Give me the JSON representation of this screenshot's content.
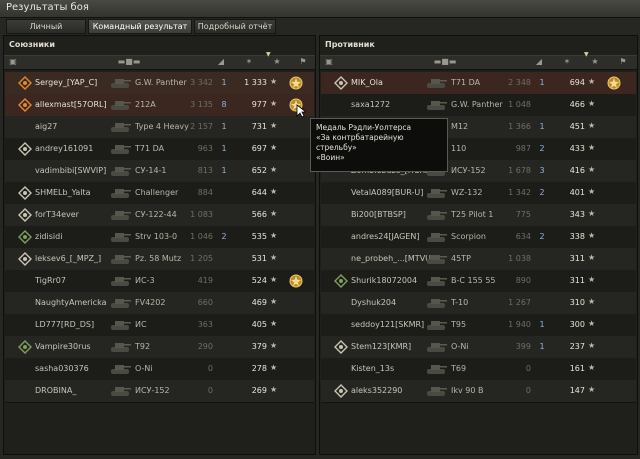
{
  "window": {
    "title": "Результаты боя"
  },
  "tabs": [
    "Личный результат",
    "Командный результат",
    "Подробный отчёт"
  ],
  "allies": {
    "title": "Союзники",
    "rows": [
      {
        "player": "Sergey_[YAP_C]",
        "tank": "G.W. Panther",
        "dmg": "3 342",
        "frags": "1",
        "xp": "1 333",
        "icon": "vehicle-icon-orange",
        "medal": true,
        "state": "me"
      },
      {
        "player": "allexmast[57ORL]",
        "tank": "212A",
        "dmg": "3 135",
        "frags": "8",
        "xp": "977",
        "icon": "vehicle-icon-orange",
        "medal": true,
        "state": "mark"
      },
      {
        "player": "aig27",
        "tank": "Type 4 Heavy",
        "dmg": "2 157",
        "frags": "1",
        "xp": "731",
        "icon": "",
        "medal": false,
        "state": "dead"
      },
      {
        "player": "andrey161091",
        "tank": "T71 DA",
        "dmg": "963",
        "frags": "1",
        "xp": "697",
        "icon": "vehicle-icon",
        "medal": false,
        "state": "dead"
      },
      {
        "player": "vadimbibi[SWVIP]",
        "tank": "СУ-14-1",
        "dmg": "813",
        "frags": "1",
        "xp": "652",
        "icon": "",
        "medal": false,
        "state": "dead"
      },
      {
        "player": "SHMELb_Yalta",
        "tank": "Challenger",
        "dmg": "884",
        "frags": "",
        "xp": "644",
        "icon": "vehicle-icon",
        "medal": false,
        "state": "dead"
      },
      {
        "player": "forT34ever",
        "tank": "СУ-122-44",
        "dmg": "1 083",
        "frags": "",
        "xp": "566",
        "icon": "vehicle-icon",
        "medal": false,
        "state": "dead"
      },
      {
        "player": "zidisidi",
        "tank": "Strv 103-0",
        "dmg": "1 046",
        "frags": "2",
        "xp": "535",
        "icon": "vehicle-icon-green",
        "medal": false,
        "state": "dead"
      },
      {
        "player": "leksev6_[_MPZ_]",
        "tank": "Pz. 58 Mutz",
        "dmg": "1 205",
        "frags": "",
        "xp": "531",
        "icon": "vehicle-icon",
        "medal": false,
        "state": "dead"
      },
      {
        "player": "TigRr07",
        "tank": "ИС-3",
        "dmg": "419",
        "frags": "",
        "xp": "524",
        "icon": "",
        "medal": true,
        "state": "dead"
      },
      {
        "player": "NaughtyAmericka",
        "tank": "FV4202",
        "dmg": "660",
        "frags": "",
        "xp": "469",
        "icon": "",
        "medal": false,
        "state": "dead"
      },
      {
        "player": "LD777[RD_DS]",
        "tank": "ИС",
        "dmg": "363",
        "frags": "",
        "xp": "405",
        "icon": "",
        "medal": false,
        "state": "dead"
      },
      {
        "player": "Vampire30rus",
        "tank": "T92",
        "dmg": "290",
        "frags": "",
        "xp": "379",
        "icon": "vehicle-icon-green",
        "medal": false,
        "state": "dead"
      },
      {
        "player": "sasha030376",
        "tank": "O-Ni",
        "dmg": "0",
        "frags": "",
        "xp": "278",
        "icon": "",
        "medal": false,
        "state": "dead"
      },
      {
        "player": "DROBINA_",
        "tank": "ИСУ-152",
        "dmg": "0",
        "frags": "",
        "xp": "269",
        "icon": "",
        "medal": false,
        "state": "dead"
      }
    ]
  },
  "enemies": {
    "title": "Противник",
    "rows": [
      {
        "player": "MIK_Ola",
        "tank": "T71 DA",
        "dmg": "2 348",
        "frags": "1",
        "xp": "694",
        "icon": "vehicle-icon",
        "medal": true,
        "state": "mark"
      },
      {
        "player": "saxa1272",
        "tank": "G.W. Panther",
        "dmg": "1 048",
        "frags": "",
        "xp": "466",
        "icon": "",
        "medal": false,
        "state": "dead"
      },
      {
        "player": "",
        "tank": "M12",
        "dmg": "1 366",
        "frags": "1",
        "xp": "451",
        "icon": "",
        "medal": false,
        "state": "dead"
      },
      {
        "player": "",
        "tank": "110",
        "dmg": "987",
        "frags": "2",
        "xp": "433",
        "icon": "",
        "medal": false,
        "state": "dead"
      },
      {
        "player": "Zombiebuzo_[HCRS]",
        "tank": "ИСУ-152",
        "dmg": "1 678",
        "frags": "3",
        "xp": "416",
        "icon": "",
        "medal": false,
        "state": "dead"
      },
      {
        "player": "VetalA089[BUR-U]",
        "tank": "WZ-132",
        "dmg": "1 342",
        "frags": "2",
        "xp": "401",
        "icon": "",
        "medal": false,
        "state": "dead"
      },
      {
        "player": "Bi200[BTBSP]",
        "tank": "T25 Pilot 1",
        "dmg": "775",
        "frags": "",
        "xp": "343",
        "icon": "",
        "medal": false,
        "state": "dead"
      },
      {
        "player": "andres24[JAGEN]",
        "tank": "Scorpion",
        "dmg": "634",
        "frags": "2",
        "xp": "338",
        "icon": "",
        "medal": false,
        "state": "dead"
      },
      {
        "player": "ne_probeh_...[MTVU]",
        "tank": "45TP",
        "dmg": "1 038",
        "frags": "",
        "xp": "311",
        "icon": "",
        "medal": false,
        "state": "dead"
      },
      {
        "player": "Shurik18072004",
        "tank": "B-C 155 55",
        "dmg": "890",
        "frags": "",
        "xp": "311",
        "icon": "vehicle-icon-green",
        "medal": false,
        "state": "dead"
      },
      {
        "player": "Dyshuk204",
        "tank": "T-10",
        "dmg": "1 267",
        "frags": "",
        "xp": "310",
        "icon": "",
        "medal": false,
        "state": "dead"
      },
      {
        "player": "seddoy121[SKMR]",
        "tank": "T95",
        "dmg": "1 940",
        "frags": "1",
        "xp": "300",
        "icon": "",
        "medal": false,
        "state": "dead"
      },
      {
        "player": "Stem123[KMR]",
        "tank": "O-Ni",
        "dmg": "399",
        "frags": "1",
        "xp": "237",
        "icon": "vehicle-icon",
        "medal": false,
        "state": "dead"
      },
      {
        "player": "Kisten_13s",
        "tank": "T69",
        "dmg": "0",
        "frags": "",
        "xp": "161",
        "icon": "",
        "medal": false,
        "state": "dead"
      },
      {
        "player": "aleks352290",
        "tank": "Ikv 90 B",
        "dmg": "0",
        "frags": "",
        "xp": "147",
        "icon": "vehicle-icon",
        "medal": false,
        "state": "dead"
      }
    ]
  },
  "tooltip": {
    "line1": "Медаль Рэдли-Уолтерса",
    "line2": "«За контрбатарейную стрельбу»",
    "line3": "«Воин»"
  },
  "colors": {
    "frags": "#8fb3dd",
    "accent": "#d7cf9a",
    "me_row": "#3a2a22",
    "mark_row": "#3b2620"
  }
}
